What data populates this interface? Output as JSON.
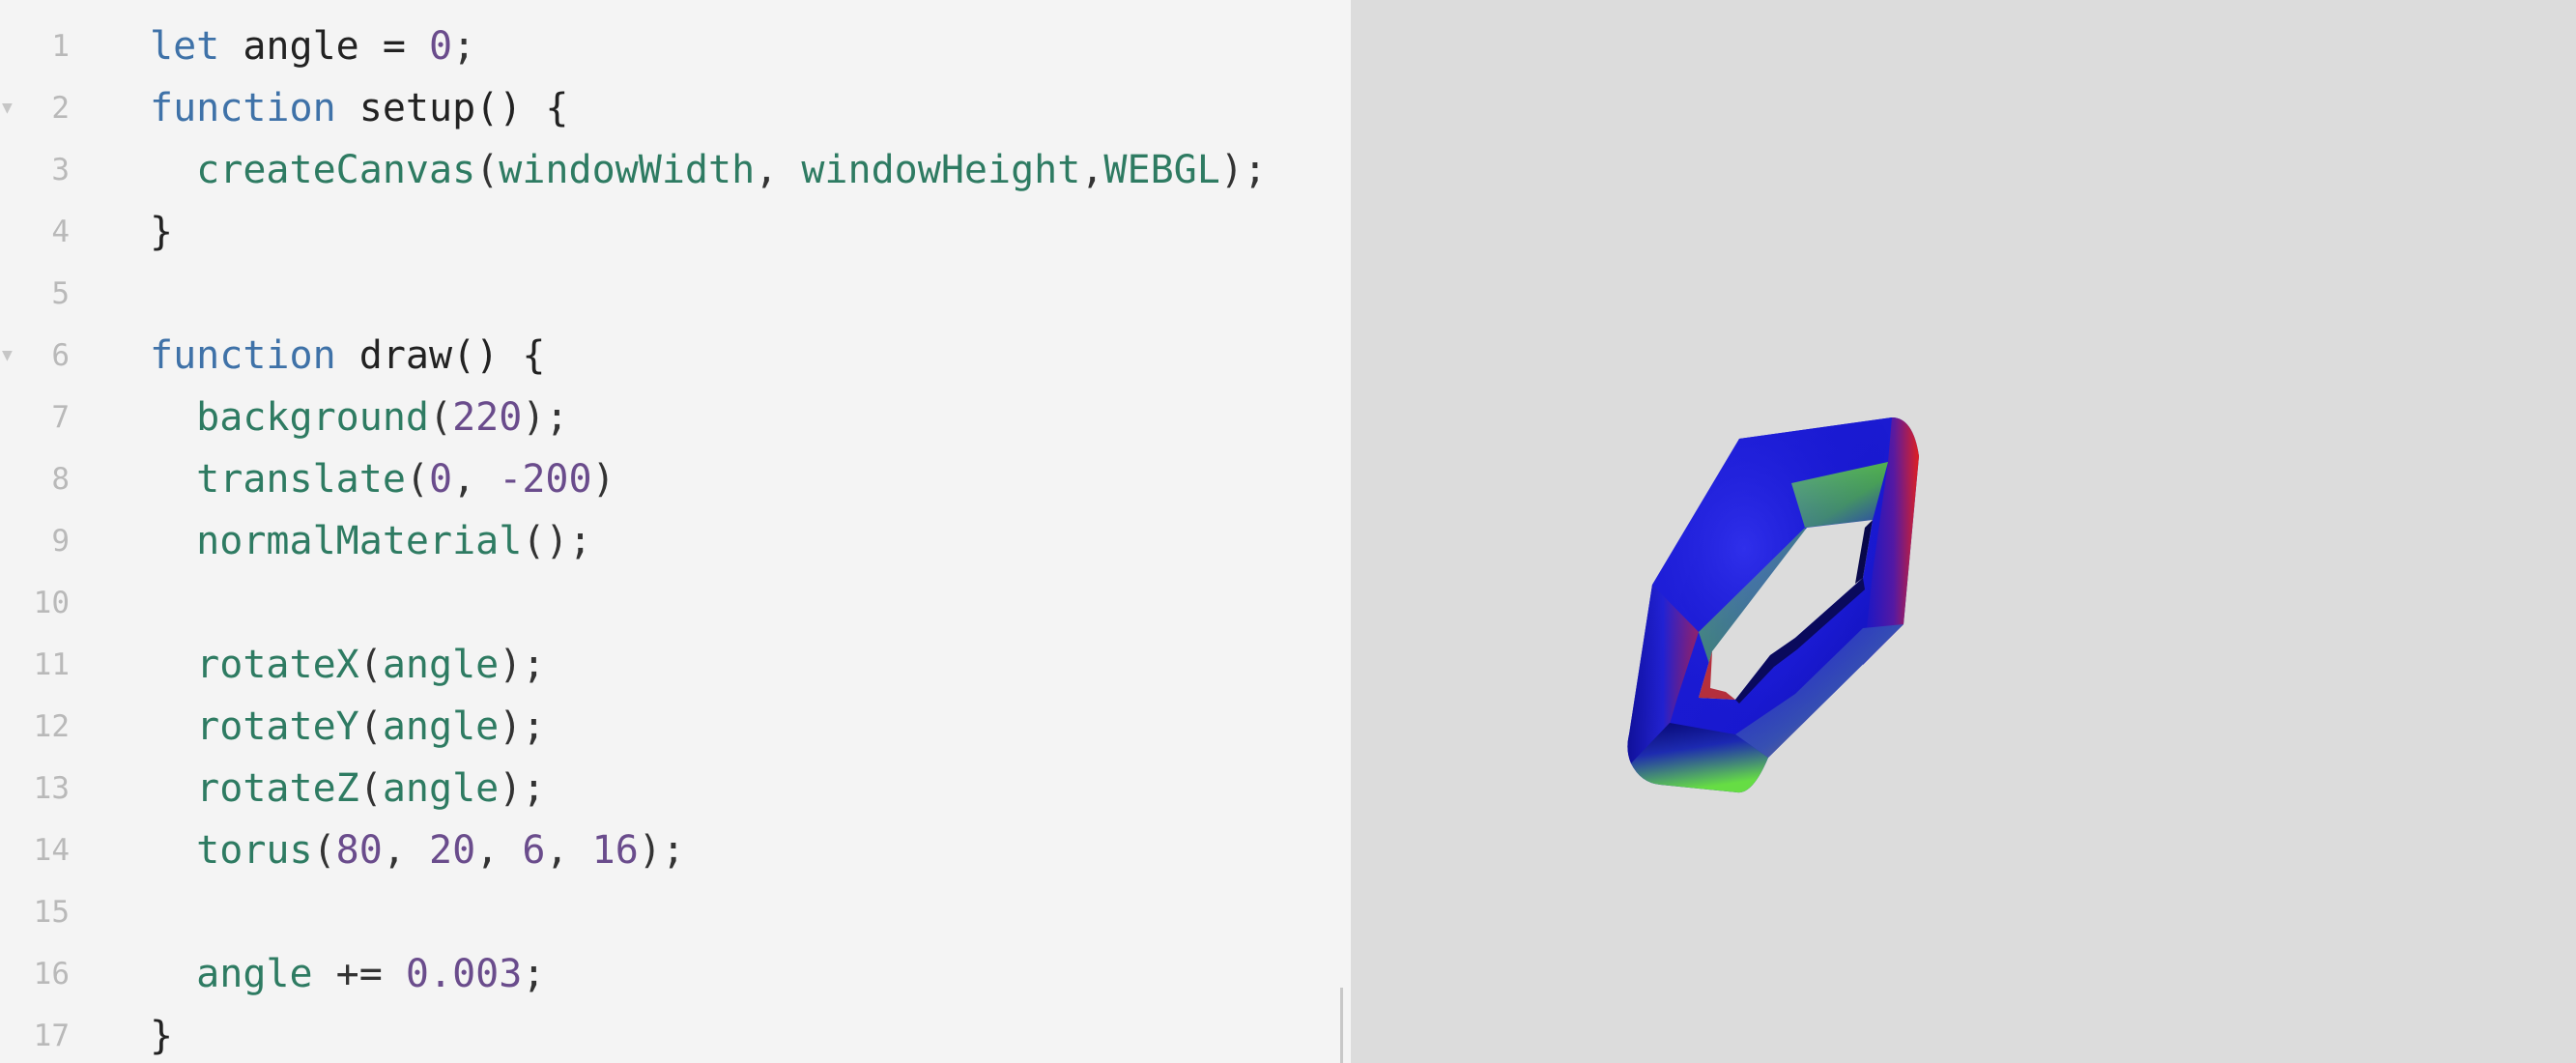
{
  "editor": {
    "lines": [
      {
        "number": "1",
        "fold": false,
        "tokens": [
          {
            "t": "let",
            "c": "keyword"
          },
          {
            "t": " angle = ",
            "c": "name"
          },
          {
            "t": "0",
            "c": "number"
          },
          {
            "t": ";",
            "c": "punct"
          }
        ]
      },
      {
        "number": "2",
        "fold": true,
        "tokens": [
          {
            "t": "function",
            "c": "keyword"
          },
          {
            "t": " setup() {",
            "c": "name"
          }
        ]
      },
      {
        "number": "3",
        "fold": false,
        "tokens": [
          {
            "t": "  createCanvas",
            "c": "call"
          },
          {
            "t": "(",
            "c": "punct"
          },
          {
            "t": "windowWidth",
            "c": "call"
          },
          {
            "t": ", ",
            "c": "punct"
          },
          {
            "t": "windowHeight",
            "c": "call"
          },
          {
            "t": ",",
            "c": "punct"
          },
          {
            "t": "WEBGL",
            "c": "call"
          },
          {
            "t": ");",
            "c": "punct"
          }
        ]
      },
      {
        "number": "4",
        "fold": false,
        "tokens": [
          {
            "t": "}",
            "c": "name"
          }
        ]
      },
      {
        "number": "5",
        "fold": false,
        "tokens": []
      },
      {
        "number": "6",
        "fold": true,
        "tokens": [
          {
            "t": "function",
            "c": "keyword"
          },
          {
            "t": " draw() {",
            "c": "name"
          }
        ]
      },
      {
        "number": "7",
        "fold": false,
        "tokens": [
          {
            "t": "  background",
            "c": "call"
          },
          {
            "t": "(",
            "c": "punct"
          },
          {
            "t": "220",
            "c": "number"
          },
          {
            "t": ");",
            "c": "punct"
          }
        ]
      },
      {
        "number": "8",
        "fold": false,
        "tokens": [
          {
            "t": "  translate",
            "c": "call"
          },
          {
            "t": "(",
            "c": "punct"
          },
          {
            "t": "0",
            "c": "number"
          },
          {
            "t": ", ",
            "c": "punct"
          },
          {
            "t": "-200",
            "c": "number"
          },
          {
            "t": ")",
            "c": "punct"
          }
        ]
      },
      {
        "number": "9",
        "fold": false,
        "tokens": [
          {
            "t": "  normalMaterial",
            "c": "call"
          },
          {
            "t": "();",
            "c": "punct"
          }
        ]
      },
      {
        "number": "10",
        "fold": false,
        "tokens": []
      },
      {
        "number": "11",
        "fold": false,
        "tokens": [
          {
            "t": "  rotateX",
            "c": "call"
          },
          {
            "t": "(",
            "c": "punct"
          },
          {
            "t": "angle",
            "c": "call"
          },
          {
            "t": ");",
            "c": "punct"
          }
        ]
      },
      {
        "number": "12",
        "fold": false,
        "tokens": [
          {
            "t": "  rotateY",
            "c": "call"
          },
          {
            "t": "(",
            "c": "punct"
          },
          {
            "t": "angle",
            "c": "call"
          },
          {
            "t": ");",
            "c": "punct"
          }
        ]
      },
      {
        "number": "13",
        "fold": false,
        "tokens": [
          {
            "t": "  rotateZ",
            "c": "call"
          },
          {
            "t": "(",
            "c": "punct"
          },
          {
            "t": "angle",
            "c": "call"
          },
          {
            "t": ");",
            "c": "punct"
          }
        ]
      },
      {
        "number": "14",
        "fold": false,
        "tokens": [
          {
            "t": "  torus",
            "c": "call"
          },
          {
            "t": "(",
            "c": "punct"
          },
          {
            "t": "80",
            "c": "number"
          },
          {
            "t": ", ",
            "c": "punct"
          },
          {
            "t": "20",
            "c": "number"
          },
          {
            "t": ", ",
            "c": "punct"
          },
          {
            "t": "6",
            "c": "number"
          },
          {
            "t": ", ",
            "c": "punct"
          },
          {
            "t": "16",
            "c": "number"
          },
          {
            "t": ");",
            "c": "punct"
          }
        ]
      },
      {
        "number": "15",
        "fold": false,
        "tokens": []
      },
      {
        "number": "16",
        "fold": false,
        "tokens": [
          {
            "t": "  angle",
            "c": "call"
          },
          {
            "t": " += ",
            "c": "punct"
          },
          {
            "t": "0.003",
            "c": "number"
          },
          {
            "t": ";",
            "c": "punct"
          }
        ]
      },
      {
        "number": "17",
        "fold": false,
        "tokens": [
          {
            "t": "}",
            "c": "name"
          }
        ]
      }
    ]
  },
  "preview": {
    "background": "#dcdcdc",
    "shape": "torus"
  },
  "colors": {
    "editor_bg": "#f4f4f4",
    "keyword": "#3f72a8",
    "call": "#2e7b62",
    "number": "#6a4c8c",
    "line_number": "#b9b9b9"
  }
}
